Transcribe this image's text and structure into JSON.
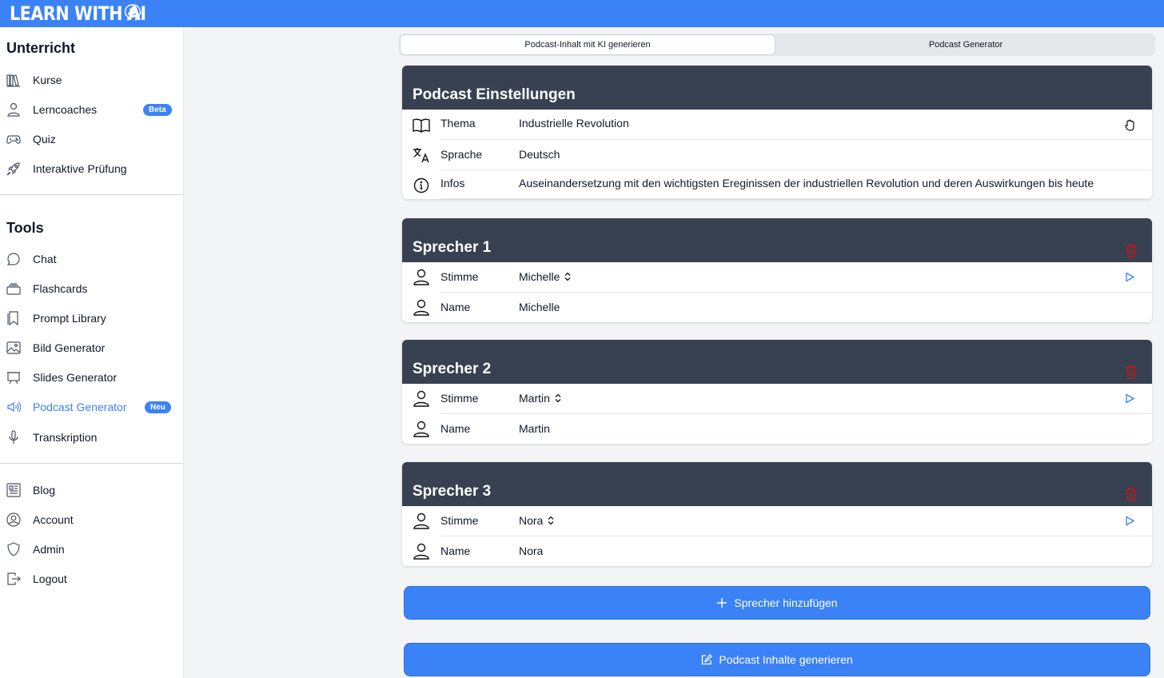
{
  "app": {
    "logo_text": "LEARN WITH AI",
    "brand_color": "#3b82f6"
  },
  "sidebar": {
    "unterricht_title": "Unterricht",
    "unterricht_items": [
      {
        "label": "Kurse",
        "icon": "books-icon"
      },
      {
        "label": "Lerncoaches",
        "icon": "person-icon",
        "badge": "Beta"
      },
      {
        "label": "Quiz",
        "icon": "gamepad-icon"
      },
      {
        "label": "Interaktive Prüfung",
        "icon": "rocket-icon"
      }
    ],
    "tools_title": "Tools",
    "tools_items": [
      {
        "label": "Chat",
        "icon": "chat-bubble-icon"
      },
      {
        "label": "Flashcards",
        "icon": "cards-stack-icon"
      },
      {
        "label": "Prompt Library",
        "icon": "bookmark-icon"
      },
      {
        "label": "Bild Generator",
        "icon": "image-icon"
      },
      {
        "label": "Slides Generator",
        "icon": "presentation-icon"
      },
      {
        "label": "Podcast Generator",
        "icon": "speaker-wave-icon",
        "badge": "Neu",
        "active": true
      },
      {
        "label": "Transkription",
        "icon": "microphone-icon"
      }
    ],
    "other_items": [
      {
        "label": "Blog",
        "icon": "newspaper-icon"
      },
      {
        "label": "Account",
        "icon": "user-circle-icon"
      },
      {
        "label": "Admin",
        "icon": "shield-icon"
      },
      {
        "label": "Logout",
        "icon": "logout-icon"
      }
    ]
  },
  "tabs": [
    {
      "label": "Podcast-Inhalt mit KI generieren",
      "active": true
    },
    {
      "label": "Podcast Generator",
      "active": false
    }
  ],
  "settings": {
    "title": "Podcast Einstellungen",
    "rows": [
      {
        "label": "Thema",
        "value": "Industrielle Revolution",
        "icon": "open-book-icon"
      },
      {
        "label": "Sprache",
        "value": "Deutsch",
        "icon": "translate-icon"
      },
      {
        "label": "Infos",
        "value": "Auseinandersetzung mit den wichtigsten Ereginissen der industriellen Revolution und deren Auswirkungen bis heute",
        "icon": "info-circle-icon"
      }
    ]
  },
  "speakers": [
    {
      "title": "Sprecher 1",
      "voice_label": "Stimme",
      "voice": "Michelle",
      "name_label": "Name",
      "name": "Michelle"
    },
    {
      "title": "Sprecher 2",
      "voice_label": "Stimme",
      "voice": "Martin",
      "name_label": "Name",
      "name": "Martin"
    },
    {
      "title": "Sprecher 3",
      "voice_label": "Stimme",
      "voice": "Nora",
      "name_label": "Name",
      "name": "Nora"
    }
  ],
  "actions": {
    "add_speaker": "Sprecher hinzufügen",
    "generate": "Podcast Inhalte generieren"
  },
  "colors": {
    "header_dark": "#374151",
    "delete_red": "#dc2626",
    "accent_blue": "#3b82f6"
  }
}
